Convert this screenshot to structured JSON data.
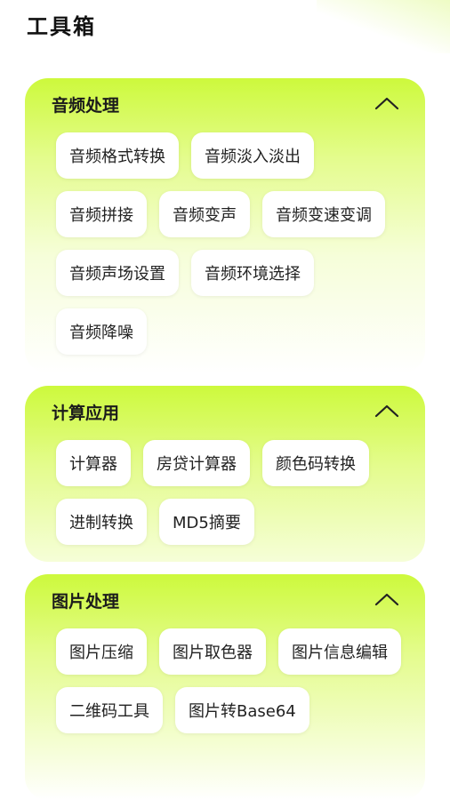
{
  "page": {
    "title": "工具箱"
  },
  "sections": [
    {
      "title": "音频处理",
      "toggle_icon": "chevron-up-icon",
      "items": [
        "音频格式转换",
        "音频淡入淡出",
        "音频拼接",
        "音频变声",
        "音频变速变调",
        "音频声场设置",
        "音频环境选择",
        "音频降噪"
      ]
    },
    {
      "title": "计算应用",
      "toggle_icon": "chevron-up-icon",
      "items": [
        "计算器",
        "房贷计算器",
        "颜色码转换",
        "进制转换",
        "MD5摘要"
      ]
    },
    {
      "title": "图片处理",
      "toggle_icon": "chevron-up-icon",
      "items": [
        "图片压缩",
        "图片取色器",
        "图片信息编辑",
        "二维码工具",
        "图片转Base64"
      ]
    }
  ],
  "colors": {
    "accent": "#cdf93c",
    "chip_bg": "#ffffff",
    "text": "#1b1b1b"
  }
}
